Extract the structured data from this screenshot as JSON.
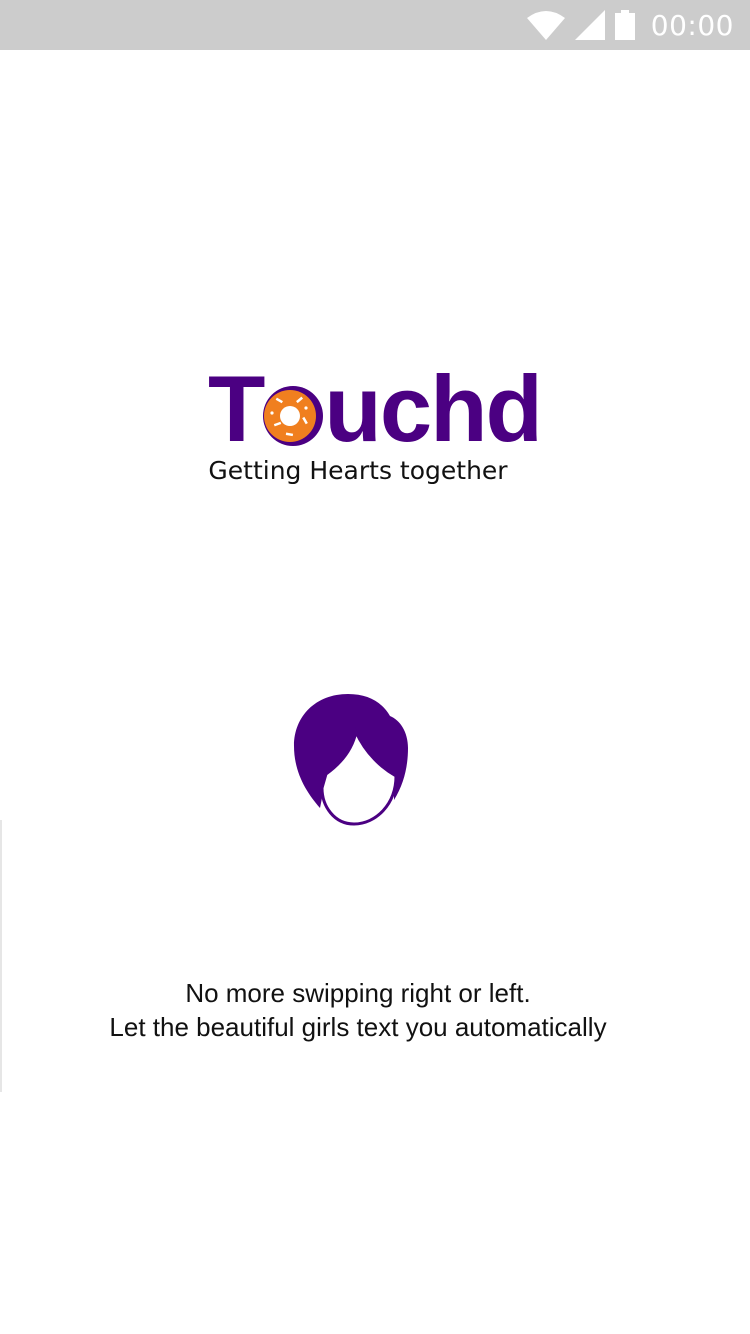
{
  "status_bar": {
    "time": "00:00",
    "icons": [
      "wifi-icon",
      "signal-icon",
      "battery-icon"
    ]
  },
  "logo": {
    "word_start": "T",
    "word_end": "uchd",
    "tagline": "Getting Hearts together"
  },
  "avatar": {
    "icon": "female-avatar-icon"
  },
  "message": {
    "line1": "No more swipping right or left.",
    "line2": "Let the beautiful girls text you automatically"
  },
  "colors": {
    "brand": "#4b0082",
    "donut": "#f07f1f",
    "status_bar": "#cccccc"
  }
}
